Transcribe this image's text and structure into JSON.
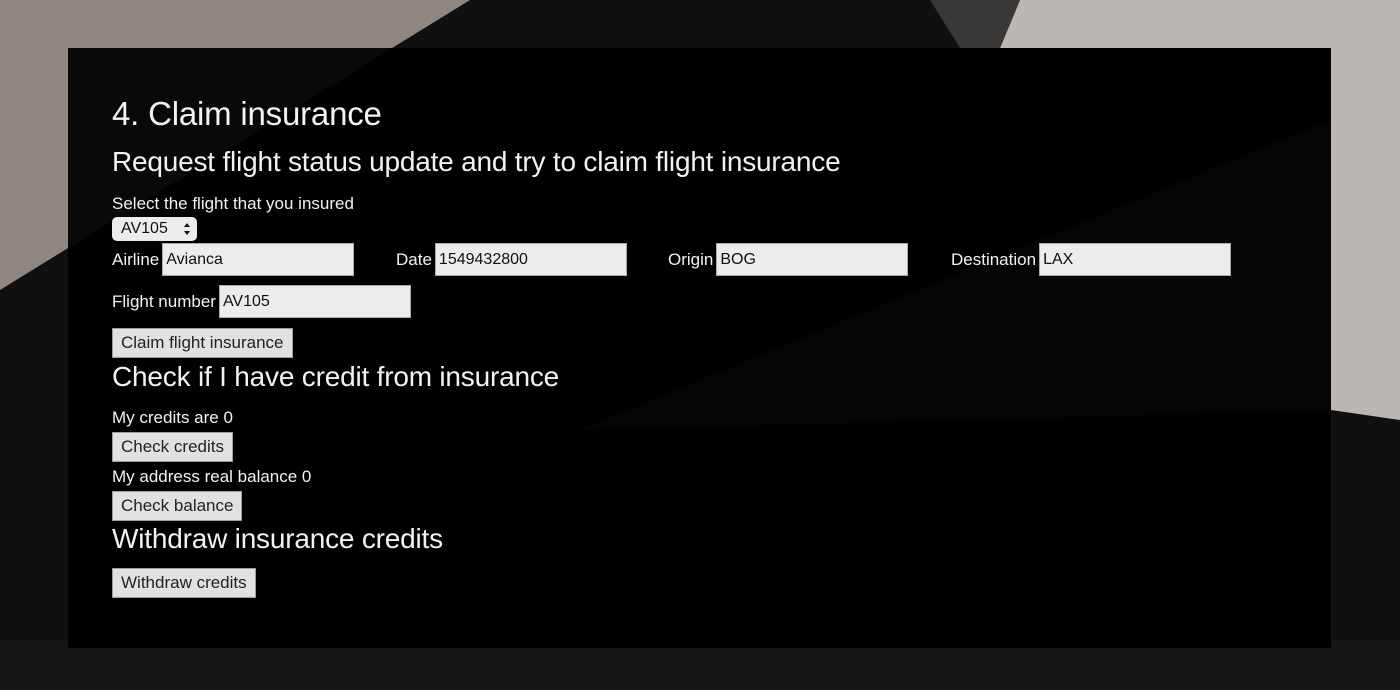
{
  "header": {
    "title": "4. Claim insurance"
  },
  "claim": {
    "heading": "Request flight status update and try to claim flight insurance",
    "select_label": "Select the flight that you insured",
    "selected_flight": "AV105",
    "fields": {
      "airline": {
        "label": "Airline",
        "value": "Avianca"
      },
      "date": {
        "label": "Date",
        "value": "1549432800"
      },
      "origin": {
        "label": "Origin",
        "value": "BOG"
      },
      "destination": {
        "label": "Destination",
        "value": "LAX"
      },
      "flight_number": {
        "label": "Flight number",
        "value": "AV105"
      }
    },
    "claim_button": "Claim flight insurance"
  },
  "credits": {
    "heading": "Check if I have credit from insurance",
    "credits_text": "My credits are 0",
    "check_credits_button": "Check credits",
    "balance_text": "My address real balance 0",
    "check_balance_button": "Check balance"
  },
  "withdraw": {
    "heading": "Withdraw insurance credits",
    "withdraw_button": "Withdraw credits"
  },
  "colors": {
    "panel": "#000000",
    "text": "#f2f2f2",
    "input_bg": "#ececec",
    "button_bg": "#e1e1e1"
  }
}
